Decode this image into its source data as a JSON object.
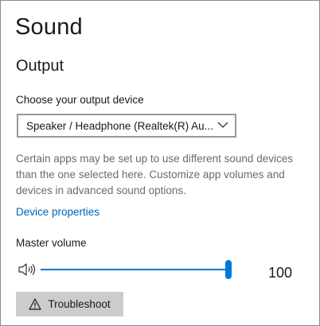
{
  "page": {
    "title": "Sound"
  },
  "output": {
    "section_title": "Output",
    "device_label": "Choose your output device",
    "device_value": "Speaker / Headphone (Realtek(R) Au...",
    "description": "Certain apps may be set up to use different sound devices than the one selected here. Customize app volumes and devices in advanced sound options.",
    "device_properties_link": "Device properties",
    "volume_label": "Master volume",
    "volume_value": "100",
    "volume_level": 1.0,
    "troubleshoot_label": "Troubleshoot"
  },
  "icons": {
    "speaker": "speaker-icon",
    "warning": "warning-icon",
    "chevron": "chevron-down-icon"
  },
  "colors": {
    "accent": "#0078d7",
    "link": "#0063b1",
    "secondary_text": "#6b6b6b",
    "button_bg": "#cccccc"
  }
}
